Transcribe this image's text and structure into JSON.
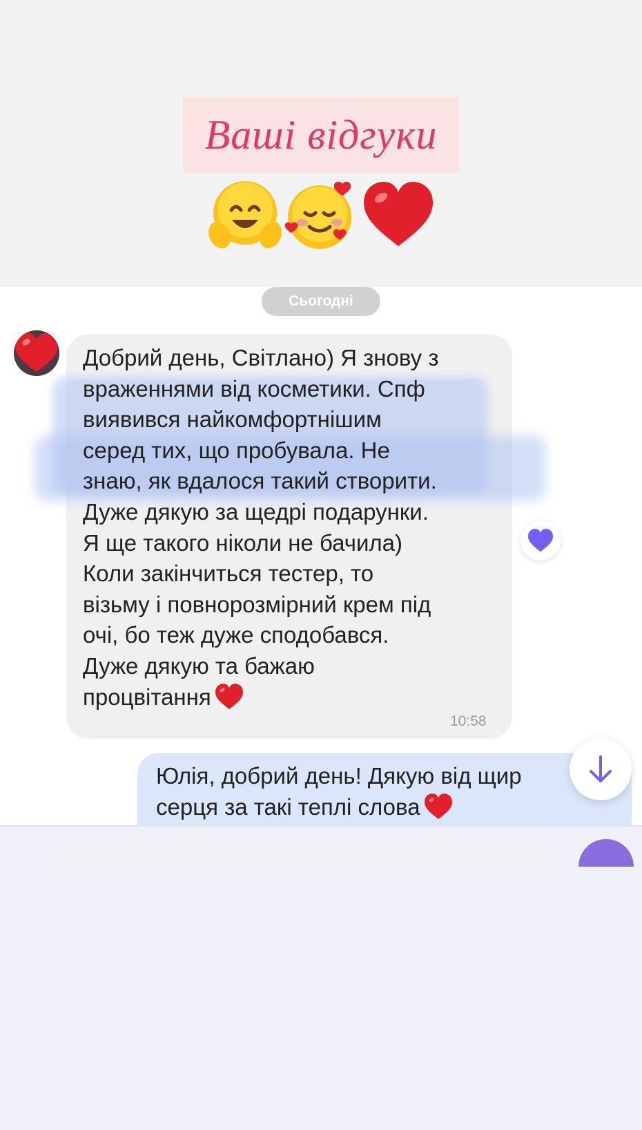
{
  "header": {
    "title": "Ваші відгуки",
    "emojis": [
      "smiling-hugging-face-icon",
      "smiling-face-with-hearts-icon",
      "red-heart-icon"
    ]
  },
  "chat": {
    "date_label": "Сьогодні",
    "incoming": {
      "lines": [
        "Добрий день, Світлано) Я знову з",
        "враженнями від косметики. Спф",
        "виявився найкомфортнішим",
        "серед тих, що пробувала. Не",
        "знаю, як вдалося такий створити.",
        "Дуже дякую за щедрі подарунки.",
        "Я ще такого ніколи не бачила)",
        "Коли закінчиться тестер, то",
        "візьму і повнорозмірний крем під",
        "очі, бо теж дуже сподобався.",
        "Дуже дякую та бажаю",
        "процвітання"
      ],
      "time": "10:58",
      "reaction": "purple-heart-icon"
    },
    "outgoing": {
      "text": "Юлія, добрий день! Дякую від щир\nсерця за такі теплі слова"
    }
  },
  "colors": {
    "title": "#e0386a",
    "title_bg": "#fbe3e4",
    "incoming_bubble": "#f0f0f1",
    "outgoing_bubble": "#dce6fb",
    "accent": "#7360f2"
  }
}
